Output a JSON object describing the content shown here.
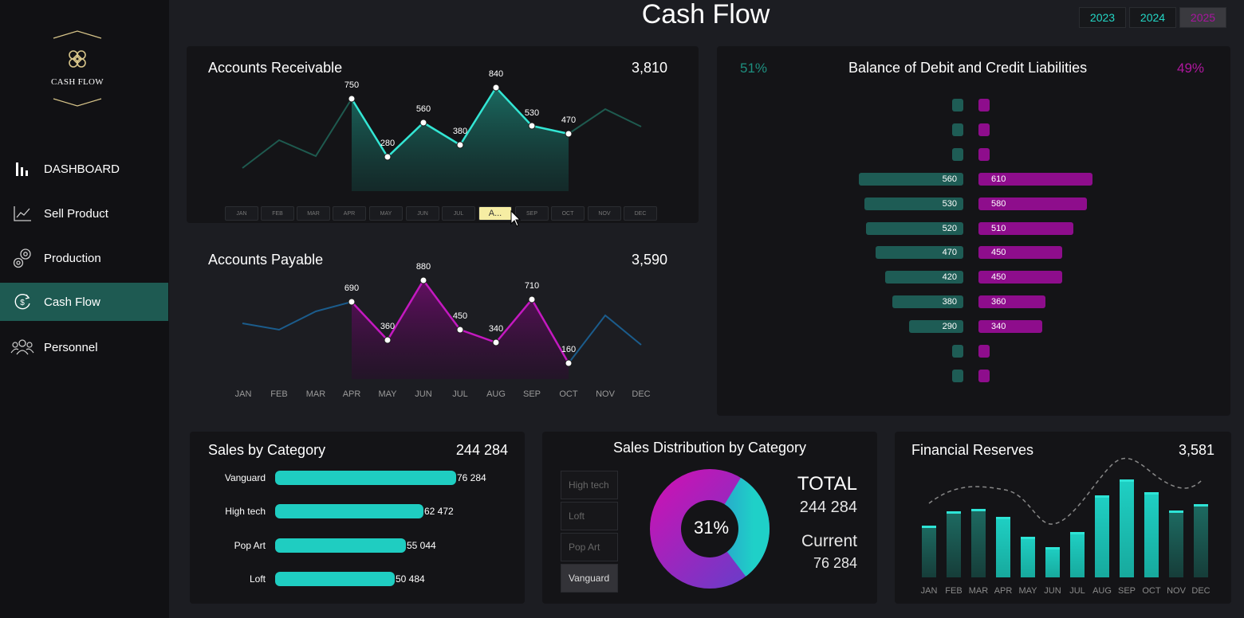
{
  "sidebar": {
    "logo_text": "CASH FLOW",
    "items": [
      {
        "label": "DASHBOARD",
        "icon": "bar-chart-icon"
      },
      {
        "label": "Sell Product",
        "icon": "line-chart-icon"
      },
      {
        "label": "Production",
        "icon": "gear-icon"
      },
      {
        "label": "Cash Flow",
        "icon": "cash-cycle-icon",
        "active": true
      },
      {
        "label": "Personnel",
        "icon": "people-icon"
      }
    ]
  },
  "header": {
    "title": "Cash Flow",
    "years": [
      "2023",
      "2024",
      "2025"
    ],
    "active_year": "2025"
  },
  "accounts_receivable": {
    "title": "Accounts Receivable",
    "total": "3,810",
    "months": [
      "JAN",
      "FEB",
      "MAR",
      "APR",
      "MAY",
      "JUN",
      "JUL",
      "A...",
      "SEP",
      "OCT",
      "NOV",
      "DEC"
    ],
    "active_month": "A...",
    "chart_data": {
      "type": "area",
      "x": [
        "JAN",
        "FEB",
        "MAR",
        "APR",
        "MAY",
        "JUN",
        "JUL",
        "AUG",
        "SEP",
        "OCT",
        "NOV",
        "DEC"
      ],
      "values": [
        null,
        null,
        null,
        750,
        280,
        560,
        380,
        840,
        530,
        470,
        null,
        null
      ],
      "labels": [
        "750",
        "280",
        "560",
        "380",
        "840",
        "530",
        "470"
      ]
    }
  },
  "accounts_payable": {
    "title": "Accounts Payable",
    "total": "3,590",
    "axis": [
      "JAN",
      "FEB",
      "MAR",
      "APR",
      "MAY",
      "JUN",
      "JUL",
      "AUG",
      "SEP",
      "OCT",
      "NOV",
      "DEC"
    ],
    "chart_data": {
      "type": "area",
      "x": [
        "JAN",
        "FEB",
        "MAR",
        "APR",
        "MAY",
        "JUN",
        "JUL",
        "AUG",
        "SEP",
        "OCT",
        "NOV",
        "DEC"
      ],
      "values": [
        null,
        null,
        null,
        690,
        360,
        880,
        450,
        340,
        710,
        160,
        null,
        null
      ],
      "labels": [
        "690",
        "360",
        "880",
        "450",
        "340",
        "710",
        "160"
      ]
    }
  },
  "balance": {
    "title": "Balance of Debit and Credit Liabilities",
    "left_pct": "51%",
    "right_pct": "49%",
    "chart_data": {
      "type": "bar",
      "debit": [
        null,
        null,
        null,
        560,
        530,
        520,
        470,
        420,
        380,
        290,
        null,
        null
      ],
      "credit": [
        null,
        null,
        null,
        610,
        580,
        510,
        450,
        450,
        360,
        340,
        null,
        null
      ]
    },
    "rows": [
      {
        "left": "",
        "right": ""
      },
      {
        "left": "",
        "right": ""
      },
      {
        "left": "",
        "right": ""
      },
      {
        "left": "560",
        "right": "610"
      },
      {
        "left": "530",
        "right": "580"
      },
      {
        "left": "520",
        "right": "510"
      },
      {
        "left": "470",
        "right": "450"
      },
      {
        "left": "420",
        "right": "450"
      },
      {
        "left": "380",
        "right": "360"
      },
      {
        "left": "290",
        "right": "340"
      },
      {
        "left": "",
        "right": ""
      },
      {
        "left": "",
        "right": ""
      }
    ]
  },
  "sales_by_category": {
    "title": "Sales by Category",
    "total": "244 284",
    "chart_data": {
      "type": "bar",
      "categories": [
        "Vanguard",
        "High tech",
        "Pop Art",
        "Loft"
      ],
      "values": [
        76284,
        62472,
        55044,
        50484
      ]
    },
    "items": [
      {
        "label": "Vanguard",
        "value": "76 284"
      },
      {
        "label": "High tech",
        "value": "62 472"
      },
      {
        "label": "Pop Art",
        "value": "55 044"
      },
      {
        "label": "Loft",
        "value": "50 484"
      }
    ]
  },
  "sales_distribution": {
    "title": "Sales Distribution by Category",
    "slicer": [
      "High tech",
      "Loft",
      "Pop Art",
      "Vanguard"
    ],
    "active": "Vanguard",
    "center_pct": "31%",
    "total_label": "TOTAL",
    "total_value": "244 284",
    "current_label": "Current",
    "current_value": "76 284",
    "chart_data": {
      "type": "pie",
      "categories": [
        "Vanguard",
        "Other"
      ],
      "values": [
        31,
        69
      ]
    }
  },
  "financial_reserves": {
    "title": "Financial Reserves",
    "total": "3,581",
    "chart_data": {
      "type": "bar",
      "categories": [
        "JAN",
        "FEB",
        "MAR",
        "APR",
        "MAY",
        "JUN",
        "JUL",
        "AUG",
        "SEP",
        "OCT",
        "NOV",
        "DEC"
      ],
      "values": [
        65,
        83,
        86,
        76,
        51,
        38,
        57,
        103,
        123,
        107,
        84,
        92
      ]
    }
  },
  "colors": {
    "teal": "#1fcdc1",
    "magenta": "#a8159f",
    "active_nav": "#1e5a52",
    "background": "#1c1d22"
  }
}
